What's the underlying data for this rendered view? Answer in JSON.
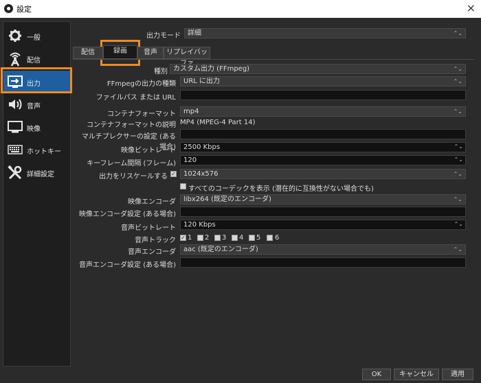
{
  "window": {
    "title": "設定",
    "close": "×"
  },
  "sidebar": {
    "items": [
      {
        "label": "一般",
        "icon": "gear-icon"
      },
      {
        "label": "配信",
        "icon": "stream-icon"
      },
      {
        "label": "出力",
        "icon": "output-icon"
      },
      {
        "label": "音声",
        "icon": "speaker-icon"
      },
      {
        "label": "映像",
        "icon": "monitor-icon"
      },
      {
        "label": "ホットキー",
        "icon": "keyboard-icon"
      },
      {
        "label": "詳細設定",
        "icon": "tools-icon"
      }
    ],
    "active": "出力"
  },
  "output_mode": {
    "label": "出力モード",
    "value": "詳細"
  },
  "tabs": [
    {
      "label": "配信"
    },
    {
      "label": "録画"
    },
    {
      "label": "音声"
    },
    {
      "label": "リプレイバッファ"
    }
  ],
  "form": {
    "type": {
      "label": "種別",
      "value": "カスタム出力 (FFmpeg)"
    },
    "ffmpeg_output_type": {
      "label": "FFmpegの出力の種類",
      "value": "URL に出力"
    },
    "file_path": {
      "label": "ファイルパス または URL",
      "value": ""
    },
    "container_format": {
      "label": "コンテナフォーマット",
      "value": "mp4"
    },
    "container_desc": {
      "label": "コンテナフォーマットの説明",
      "value": "MP4 (MPEG-4 Part 14)"
    },
    "muxer_settings": {
      "label": "マルチプレクサーの設定 (ある場合)",
      "value": ""
    },
    "video_bitrate": {
      "label": "映像ビットレート",
      "value": "2500 Kbps"
    },
    "keyframe_interval": {
      "label": "キーフレーム間隔 (フレーム)",
      "value": "120"
    },
    "rescale": {
      "label": "出力をリスケールする",
      "checked": "✓",
      "value": "1024x576"
    },
    "show_all_codecs": {
      "label": "すべてのコーデックを表示 (潜在的に互換性がない場合でも)"
    },
    "video_encoder": {
      "label": "映像エンコーダ",
      "value": "libx264 (既定のエンコーダ)"
    },
    "video_encoder_settings": {
      "label": "映像エンコーダ設定 (ある場合)",
      "value": ""
    },
    "audio_bitrate": {
      "label": "音声ビットレート",
      "value": "120 Kbps"
    },
    "audio_track": {
      "label": "音声トラック",
      "tracks": [
        "1",
        "2",
        "3",
        "4",
        "5",
        "6"
      ],
      "checked_mark": "✓"
    },
    "audio_encoder": {
      "label": "音声エンコーダ",
      "value": "aac (既定のエンコーダ)"
    },
    "audio_encoder_settings": {
      "label": "音声エンコーダ設定 (ある場合)",
      "value": ""
    }
  },
  "buttons": {
    "ok": "OK",
    "cancel": "キャンセル",
    "apply": "適用"
  },
  "colors": {
    "highlight": "#f08a24",
    "active_nav": "#1f5f9f"
  }
}
